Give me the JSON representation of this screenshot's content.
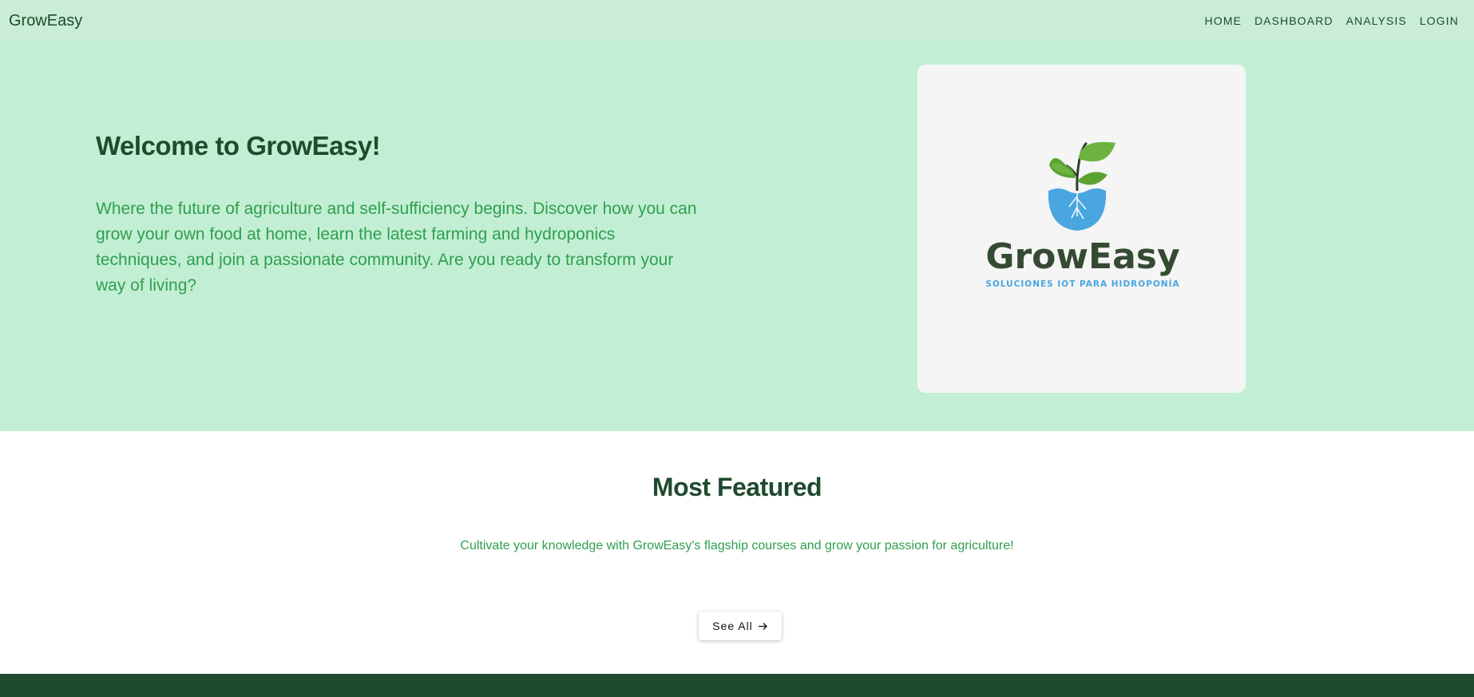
{
  "navbar": {
    "brand": "GrowEasy",
    "links": [
      "HOME",
      "DASHBOARD",
      "ANALYSIS",
      "LOGIN"
    ]
  },
  "hero": {
    "title": "Welcome to GrowEasy!",
    "text": "Where the future of agriculture and self-sufficiency begins. Discover how you can grow your own food at home, learn the latest farming and hydroponics techniques, and join a passionate community. Are you ready to transform your way of living?",
    "logo": {
      "wordmark": "GrowEasy",
      "tagline": "SOLUCIONES IOT PARA HIDROPONÍA"
    }
  },
  "featured": {
    "title": "Most Featured",
    "text": "Cultivate your knowledge with GrowEasy's flagship courses and grow your passion for agriculture!",
    "button_label": "See All",
    "button_icon": "arrow-right-icon"
  },
  "colors": {
    "navbar_bg": "#c9edd5",
    "hero_bg": "#c2efd3",
    "dark_green": "#1f4a2e",
    "text_green": "#2f9e4f",
    "water_blue": "#4aa6e0",
    "leaf_green": "#6cb33f"
  }
}
